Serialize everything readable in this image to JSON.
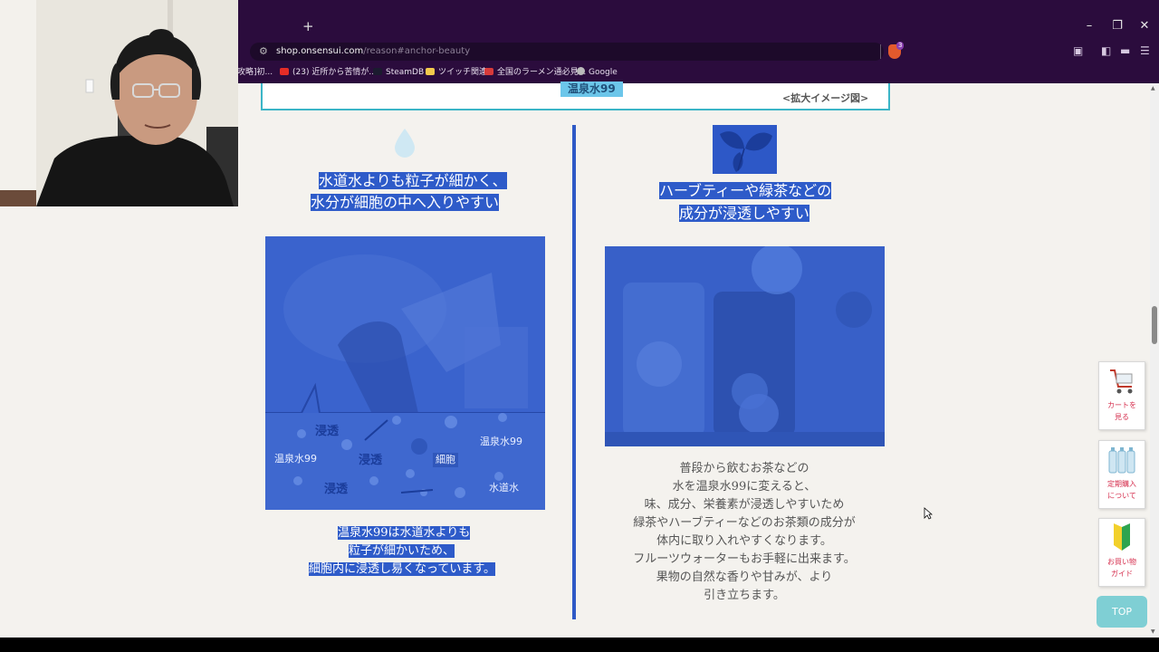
{
  "browser": {
    "new_tab": "+",
    "minimize": "–",
    "restore": "❐",
    "close": "✕",
    "url_domain": "shop.onsensui.com",
    "url_path": "/reason#anchor-beauty",
    "brave_badge": "3",
    "bookmarks": [
      {
        "label": "攻略]初...",
        "color": "#f0b44c"
      },
      {
        "label": "(23) 近所から苦情が...",
        "color": "#e52d27"
      },
      {
        "label": "SteamDB",
        "color": "#1b1b2f"
      },
      {
        "label": "ツイッチ関連",
        "color": "#f2c94c"
      },
      {
        "label": "全国のラーメン通必見...",
        "color": "#d73a3a"
      },
      {
        "label": "Google",
        "color": "#bbbbbb"
      }
    ]
  },
  "page": {
    "top_label": "温泉水99",
    "zoom_label": "<拡大イメージ図>",
    "left": {
      "heading_line1": "水道水よりも粒子が細かく、",
      "heading_line2": "水分が細胞の中へ入りやすい",
      "diagram": {
        "penetrate_1": "浸透",
        "penetrate_2": "浸透",
        "penetrate_3": "浸透",
        "onsensui_left": "温泉水99",
        "onsensui_right": "温泉水99",
        "cell": "細胞",
        "tap_water": "水道水"
      },
      "caption_line1": "温泉水99は水道水よりも",
      "caption_line2": "粒子が細かいため、",
      "caption_line3": "細胞内に浸透し易くなっています。"
    },
    "right": {
      "heading_line1": "ハーブティーや緑茶などの",
      "heading_line2": "成分が浸透しやすい",
      "description": [
        "普段から飲むお茶などの",
        "水を温泉水99に変えると、",
        "味、成分、栄養素が浸透しやすいため",
        "緑茶やハーブティーなどのお茶類の成分が",
        "体内に取り入れやすくなります。",
        "フルーツウォーターもお手軽に出来ます。",
        "果物の自然な香りや甘みが、より",
        "引き立ちます。"
      ]
    }
  },
  "side_buttons": {
    "cart_line1": "カートを",
    "cart_line2": "見る",
    "subs_line1": "定期購入",
    "subs_line2": "について",
    "guide_line1": "お買い物",
    "guide_line2": "ガイド",
    "top": "TOP"
  },
  "colors": {
    "highlight": "#2e5bc9",
    "chrome": "#2b0c3d",
    "top_button": "#7fcfd4"
  }
}
